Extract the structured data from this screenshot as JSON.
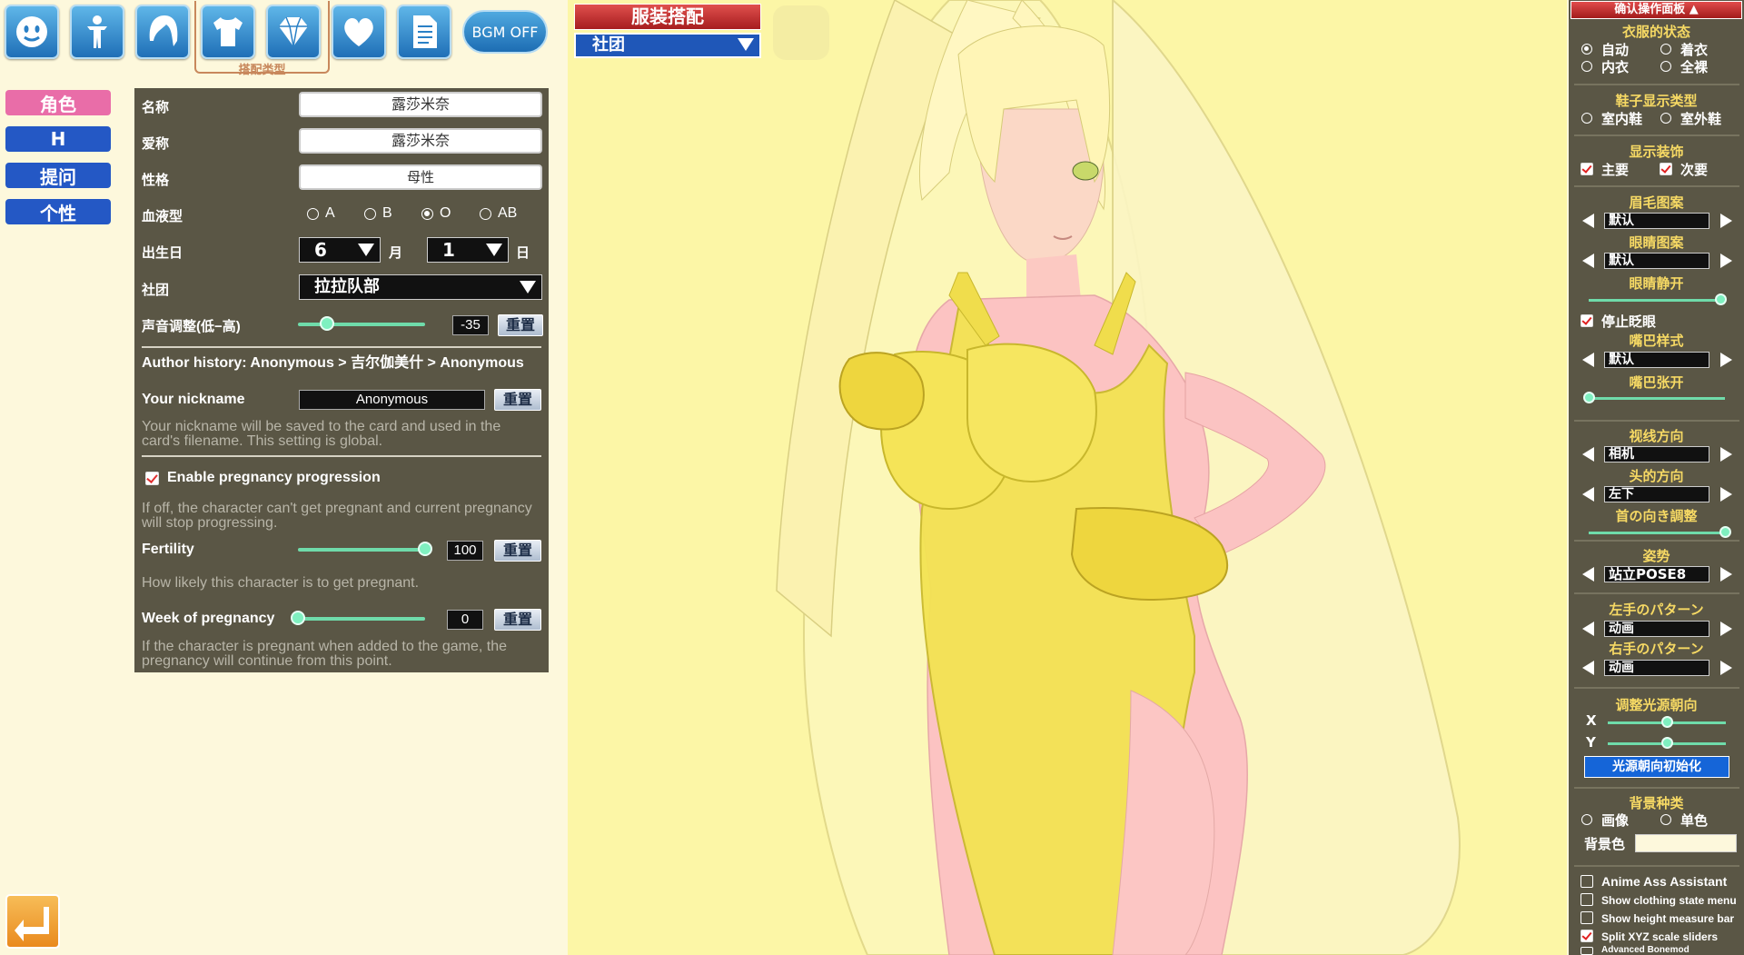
{
  "toolbar": {
    "icons": [
      "face-icon",
      "body-icon",
      "hair-icon",
      "clothes-icon",
      "accessory-icon",
      "heart-icon",
      "document-icon"
    ],
    "group_label": "搭配类型",
    "bgm_label": "BGM OFF"
  },
  "side_nav": [
    {
      "label": "角色",
      "active": true
    },
    {
      "label": "H",
      "active": false
    },
    {
      "label": "提问",
      "active": false
    },
    {
      "label": "个性",
      "active": false
    }
  ],
  "character": {
    "name_label": "名称",
    "name_value": "露莎米奈",
    "nickname_label": "爱称",
    "nickname_value": "露莎米奈",
    "personality_label": "性格",
    "personality_value": "母性",
    "blood_label": "血液型",
    "blood_options": [
      "A",
      "B",
      "O",
      "AB"
    ],
    "blood_selected": "O",
    "birthday_label": "出生日",
    "birth_month": "6",
    "month_unit": "月",
    "birth_day": "1",
    "day_unit": "日",
    "club_label": "社团",
    "club_value": "拉拉队部",
    "voice_label": "声音调整(低−高)",
    "voice_value": "-35",
    "voice_level": 0.23,
    "reset_label": "重置",
    "author_history": "Author history: Anonymous > 吉尔伽美什 > Anonymous",
    "your_nickname_label": "Your nickname",
    "your_nickname_value": "Anonymous",
    "nickname_hint": "Your nickname will be saved to the card and used in the card's filename. This setting is global.",
    "pregnancy_toggle_label": "Enable pregnancy progression",
    "pregnancy_enabled": true,
    "pregnancy_hint": "If off, the character can't get pregnant and current pregnancy will stop progressing.",
    "fertility_label": "Fertility",
    "fertility_value": "100",
    "fertility_level": 1.0,
    "fertility_hint": "How likely this character is to get pregnant.",
    "week_label": "Week of pregnancy",
    "week_value": "0",
    "week_level": 0.0,
    "week_hint": "If the character is pregnant when added to the game, the pregnancy will continue from this point."
  },
  "outfit": {
    "title": "服装搭配",
    "selected": "社团"
  },
  "right_panel": {
    "header": "确认操作面板",
    "clothes_state_title": "衣服的状态",
    "clothes_states": [
      {
        "label": "自动",
        "selected": true
      },
      {
        "label": "着衣",
        "selected": false
      },
      {
        "label": "内衣",
        "selected": false
      },
      {
        "label": "全裸",
        "selected": false
      }
    ],
    "shoe_title": "鞋子显示类型",
    "shoe_types": [
      {
        "label": "室内鞋",
        "selected": false
      },
      {
        "label": "室外鞋",
        "selected": false
      }
    ],
    "decoration_title": "显示装饰",
    "decorations": [
      {
        "label": "主要",
        "checked": true
      },
      {
        "label": "次要",
        "checked": true
      }
    ],
    "eyebrow_title": "眉毛图案",
    "eyebrow_value": "默认",
    "eye_title": "眼睛图案",
    "eye_value": "默认",
    "eye_open_title": "眼睛静开",
    "eye_open_level": 0.97,
    "stop_blink_label": "停止眨眼",
    "stop_blink": true,
    "mouth_title": "嘴巴样式",
    "mouth_value": "默认",
    "mouth_open_title": "嘴巴张开",
    "mouth_open_level": 0.0,
    "gaze_title": "视线方向",
    "gaze_value": "相机",
    "head_title": "头的方向",
    "head_value": "左下",
    "neck_title": "首の向き調整",
    "neck_level": 1.0,
    "pose_title": "姿势",
    "pose_value": "站立POSE8",
    "left_hand_title": "左手のパターン",
    "left_hand_value": "动画",
    "right_hand_title": "右手のパターン",
    "right_hand_value": "动画",
    "light_title": "调整光源朝向",
    "light_x_label": "X",
    "light_x_level": 0.5,
    "light_y_label": "Y",
    "light_y_level": 0.5,
    "light_reset_label": "光源朝向初始化",
    "bg_title": "背景种类",
    "bg_types": [
      {
        "label": "画像",
        "selected": false
      },
      {
        "label": "单色",
        "selected": false
      }
    ],
    "bg_color_label": "背景色",
    "options": [
      {
        "label": "Anime Ass Assistant",
        "checked": false,
        "size": "big"
      },
      {
        "label": "Show clothing state menu",
        "checked": false,
        "size": "small"
      },
      {
        "label": "Show height measure bar",
        "checked": false,
        "size": "small"
      },
      {
        "label": "Split XYZ scale sliders",
        "checked": true,
        "size": "small"
      },
      {
        "label": "Advanced Bonemod",
        "checked": false,
        "size": "tiny"
      }
    ]
  },
  "colors": {
    "accent_pink": "#e96da8",
    "nav_blue": "#2458c5",
    "panel_bg": "#5a5645",
    "slider": "#6fdbaa",
    "scene_bg": "#fcf6a6"
  }
}
